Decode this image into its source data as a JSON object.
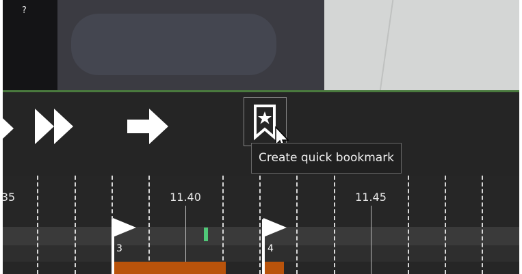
{
  "video": {
    "overlay_text": "?"
  },
  "controls": {
    "buttons": [
      {
        "name": "play-icon"
      },
      {
        "name": "fast-forward-icon"
      },
      {
        "name": "next-arrow-icon"
      },
      {
        "name": "bookmark-star-icon"
      }
    ],
    "tooltip": "Create quick bookmark"
  },
  "timeline": {
    "tick_labels": [
      {
        "text": "35"
      },
      {
        "text": "11.40"
      },
      {
        "text": "11.45"
      }
    ],
    "bookmarks": [
      {
        "label": "3"
      },
      {
        "label": "4"
      }
    ],
    "colors": {
      "segment": "#b9530b",
      "marker": "#50c878",
      "divider": "#4a7a3e"
    }
  }
}
